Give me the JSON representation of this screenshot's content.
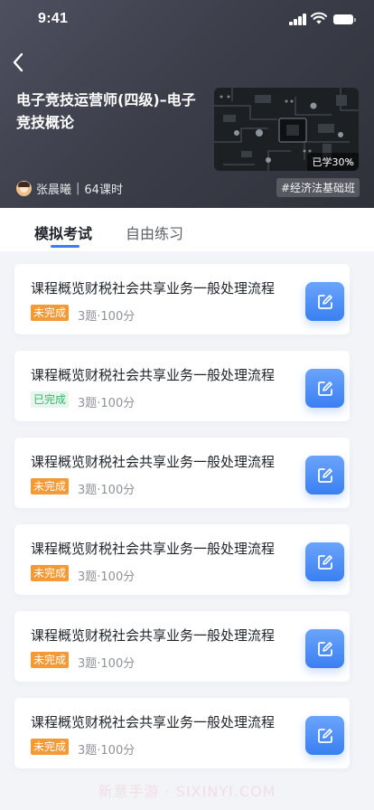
{
  "status_bar": {
    "time": "9:41"
  },
  "course": {
    "title": "电子竞技运营师(四级)–电子竞技概论",
    "progress_label": "已学30%",
    "teacher": "张晨曦",
    "lessons": "64课时",
    "tag": "#经济法基础班"
  },
  "tabs": [
    {
      "label": "模拟考试",
      "active": true
    },
    {
      "label": "自由练习",
      "active": false
    }
  ],
  "exams": [
    {
      "title": "课程概览财税社会共享业务一般处理流程",
      "status": "未完成",
      "meta": "3题·100分"
    },
    {
      "title": "课程概览财税社会共享业务一般处理流程",
      "status": "已完成",
      "meta": "3题·100分"
    },
    {
      "title": "课程概览财税社会共享业务一般处理流程",
      "status": "未完成",
      "meta": "3题·100分"
    },
    {
      "title": "课程概览财税社会共享业务一般处理流程",
      "status": "未完成",
      "meta": "3题·100分"
    },
    {
      "title": "课程概览财税社会共享业务一般处理流程",
      "status": "未完成",
      "meta": "3题·100分"
    },
    {
      "title": "课程概览财税社会共享业务一般处理流程",
      "status": "未完成",
      "meta": "3题·100分"
    }
  ],
  "icons": {
    "back": "chevron-left-icon",
    "edit": "edit-icon",
    "signal": "signal-icon",
    "wifi": "wifi-icon",
    "battery": "battery-icon"
  },
  "colors": {
    "accent": "#3a7df5",
    "pending": "#f39a36",
    "done_text": "#38b46a",
    "done_bg": "#e5f6ec"
  },
  "watermark": "新意手游 · SIXINYI.COM"
}
